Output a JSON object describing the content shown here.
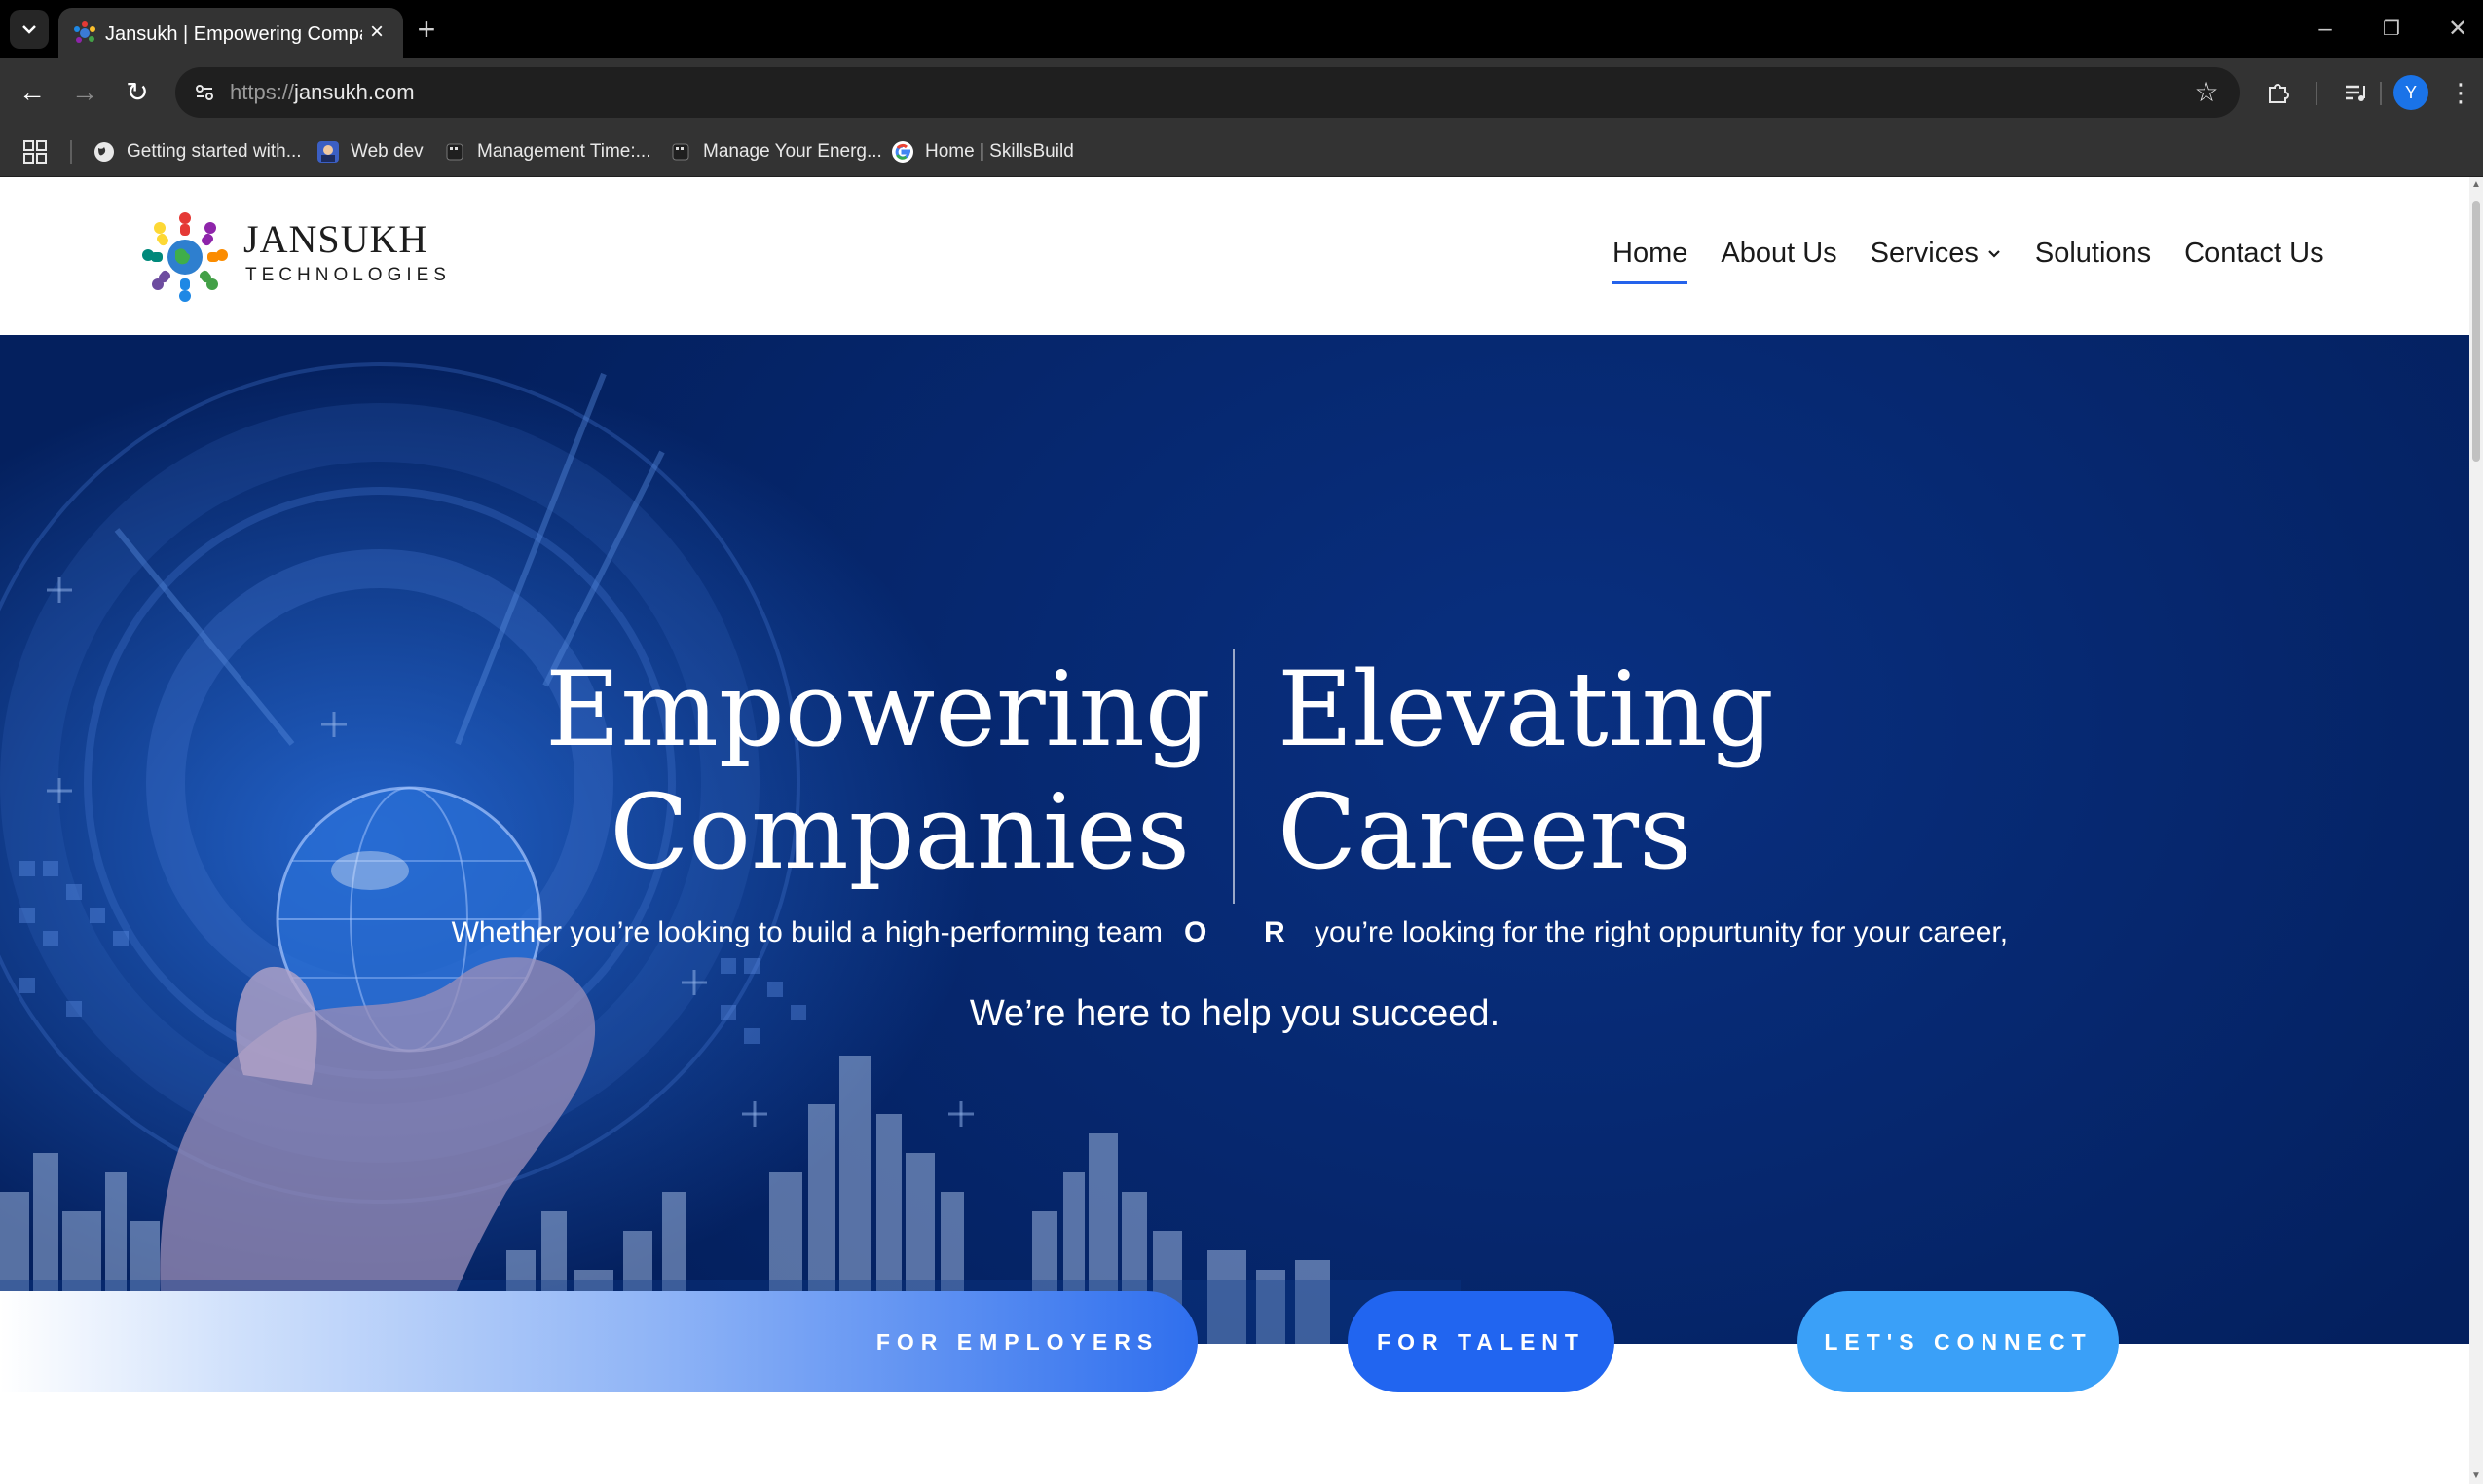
{
  "browser": {
    "tab": {
      "title": "Jansukh | Empowering Companies",
      "close_icon": "×",
      "favicon_icon": "jansukh-favicon"
    },
    "tab_search_icon": "⌄",
    "new_tab_icon": "+",
    "window": {
      "minimize": "–",
      "restore": "❐",
      "close": "✕"
    },
    "nav": {
      "back": "←",
      "forward": "→",
      "reload": "↻"
    },
    "omnibox": {
      "url_scheme": "https://",
      "url_host": "jansukh.com",
      "site_info_icon": "tune-icon",
      "star_icon": "☆"
    },
    "toolbar_icons": {
      "extensions": "extensions-icon",
      "media": "media-control-icon",
      "menu": "⋮",
      "profile_initial": "Y"
    },
    "bookmarks": [
      {
        "label": "Getting started with...",
        "icon": "globe-icon"
      },
      {
        "label": "Web dev",
        "icon": "webdev-icon"
      },
      {
        "label": "Management Time:...",
        "icon": "bookmark-icon"
      },
      {
        "label": "Manage Your Energ...",
        "icon": "bookmark-icon"
      },
      {
        "label": "Home | SkillsBuild",
        "icon": "google-icon"
      }
    ]
  },
  "site": {
    "logo": {
      "name": "JANSUKH",
      "sub": "TECHNOLOGIES"
    },
    "nav": [
      {
        "label": "Home",
        "active": true
      },
      {
        "label": "About Us"
      },
      {
        "label": "Services",
        "has_dropdown": true
      },
      {
        "label": "Solutions"
      },
      {
        "label": "Contact Us"
      }
    ],
    "hero": {
      "headline_left": [
        "Empowering",
        "Companies"
      ],
      "headline_right": [
        "Elevating",
        "Careers"
      ],
      "sub_left": "Whether you’re looking to build a high-performing team",
      "sub_o": "O",
      "sub_r": "R",
      "sub_right": "you’re looking for the right oppurtunity for your career,",
      "tagline": "We’re here to help you succeed."
    },
    "cta": {
      "employers": "FOR EMPLOYERS",
      "talent": "FOR TALENT",
      "connect": "LET'S CONNECT"
    },
    "colors": {
      "hero_bg": "#062870",
      "accent": "#2563eb",
      "cta_talent": "#2165f0",
      "cta_connect": "#3aa0f8"
    }
  }
}
